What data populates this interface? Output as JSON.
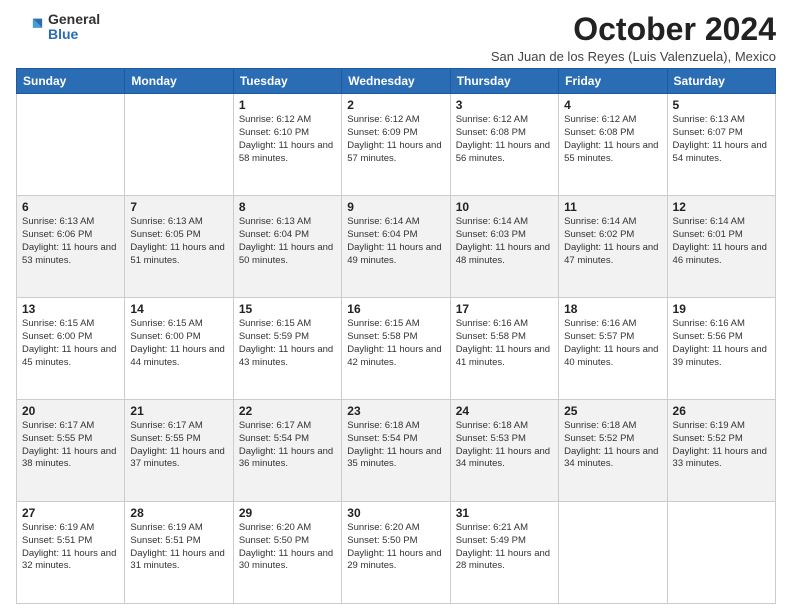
{
  "logo": {
    "general": "General",
    "blue": "Blue"
  },
  "title": "October 2024",
  "subtitle": "San Juan de los Reyes (Luis Valenzuela), Mexico",
  "weekdays": [
    "Sunday",
    "Monday",
    "Tuesday",
    "Wednesday",
    "Thursday",
    "Friday",
    "Saturday"
  ],
  "weeks": [
    [
      {
        "day": "",
        "info": ""
      },
      {
        "day": "",
        "info": ""
      },
      {
        "day": "1",
        "info": "Sunrise: 6:12 AM\nSunset: 6:10 PM\nDaylight: 11 hours and 58 minutes."
      },
      {
        "day": "2",
        "info": "Sunrise: 6:12 AM\nSunset: 6:09 PM\nDaylight: 11 hours and 57 minutes."
      },
      {
        "day": "3",
        "info": "Sunrise: 6:12 AM\nSunset: 6:08 PM\nDaylight: 11 hours and 56 minutes."
      },
      {
        "day": "4",
        "info": "Sunrise: 6:12 AM\nSunset: 6:08 PM\nDaylight: 11 hours and 55 minutes."
      },
      {
        "day": "5",
        "info": "Sunrise: 6:13 AM\nSunset: 6:07 PM\nDaylight: 11 hours and 54 minutes."
      }
    ],
    [
      {
        "day": "6",
        "info": "Sunrise: 6:13 AM\nSunset: 6:06 PM\nDaylight: 11 hours and 53 minutes."
      },
      {
        "day": "7",
        "info": "Sunrise: 6:13 AM\nSunset: 6:05 PM\nDaylight: 11 hours and 51 minutes."
      },
      {
        "day": "8",
        "info": "Sunrise: 6:13 AM\nSunset: 6:04 PM\nDaylight: 11 hours and 50 minutes."
      },
      {
        "day": "9",
        "info": "Sunrise: 6:14 AM\nSunset: 6:04 PM\nDaylight: 11 hours and 49 minutes."
      },
      {
        "day": "10",
        "info": "Sunrise: 6:14 AM\nSunset: 6:03 PM\nDaylight: 11 hours and 48 minutes."
      },
      {
        "day": "11",
        "info": "Sunrise: 6:14 AM\nSunset: 6:02 PM\nDaylight: 11 hours and 47 minutes."
      },
      {
        "day": "12",
        "info": "Sunrise: 6:14 AM\nSunset: 6:01 PM\nDaylight: 11 hours and 46 minutes."
      }
    ],
    [
      {
        "day": "13",
        "info": "Sunrise: 6:15 AM\nSunset: 6:00 PM\nDaylight: 11 hours and 45 minutes."
      },
      {
        "day": "14",
        "info": "Sunrise: 6:15 AM\nSunset: 6:00 PM\nDaylight: 11 hours and 44 minutes."
      },
      {
        "day": "15",
        "info": "Sunrise: 6:15 AM\nSunset: 5:59 PM\nDaylight: 11 hours and 43 minutes."
      },
      {
        "day": "16",
        "info": "Sunrise: 6:15 AM\nSunset: 5:58 PM\nDaylight: 11 hours and 42 minutes."
      },
      {
        "day": "17",
        "info": "Sunrise: 6:16 AM\nSunset: 5:58 PM\nDaylight: 11 hours and 41 minutes."
      },
      {
        "day": "18",
        "info": "Sunrise: 6:16 AM\nSunset: 5:57 PM\nDaylight: 11 hours and 40 minutes."
      },
      {
        "day": "19",
        "info": "Sunrise: 6:16 AM\nSunset: 5:56 PM\nDaylight: 11 hours and 39 minutes."
      }
    ],
    [
      {
        "day": "20",
        "info": "Sunrise: 6:17 AM\nSunset: 5:55 PM\nDaylight: 11 hours and 38 minutes."
      },
      {
        "day": "21",
        "info": "Sunrise: 6:17 AM\nSunset: 5:55 PM\nDaylight: 11 hours and 37 minutes."
      },
      {
        "day": "22",
        "info": "Sunrise: 6:17 AM\nSunset: 5:54 PM\nDaylight: 11 hours and 36 minutes."
      },
      {
        "day": "23",
        "info": "Sunrise: 6:18 AM\nSunset: 5:54 PM\nDaylight: 11 hours and 35 minutes."
      },
      {
        "day": "24",
        "info": "Sunrise: 6:18 AM\nSunset: 5:53 PM\nDaylight: 11 hours and 34 minutes."
      },
      {
        "day": "25",
        "info": "Sunrise: 6:18 AM\nSunset: 5:52 PM\nDaylight: 11 hours and 34 minutes."
      },
      {
        "day": "26",
        "info": "Sunrise: 6:19 AM\nSunset: 5:52 PM\nDaylight: 11 hours and 33 minutes."
      }
    ],
    [
      {
        "day": "27",
        "info": "Sunrise: 6:19 AM\nSunset: 5:51 PM\nDaylight: 11 hours and 32 minutes."
      },
      {
        "day": "28",
        "info": "Sunrise: 6:19 AM\nSunset: 5:51 PM\nDaylight: 11 hours and 31 minutes."
      },
      {
        "day": "29",
        "info": "Sunrise: 6:20 AM\nSunset: 5:50 PM\nDaylight: 11 hours and 30 minutes."
      },
      {
        "day": "30",
        "info": "Sunrise: 6:20 AM\nSunset: 5:50 PM\nDaylight: 11 hours and 29 minutes."
      },
      {
        "day": "31",
        "info": "Sunrise: 6:21 AM\nSunset: 5:49 PM\nDaylight: 11 hours and 28 minutes."
      },
      {
        "day": "",
        "info": ""
      },
      {
        "day": "",
        "info": ""
      }
    ]
  ]
}
